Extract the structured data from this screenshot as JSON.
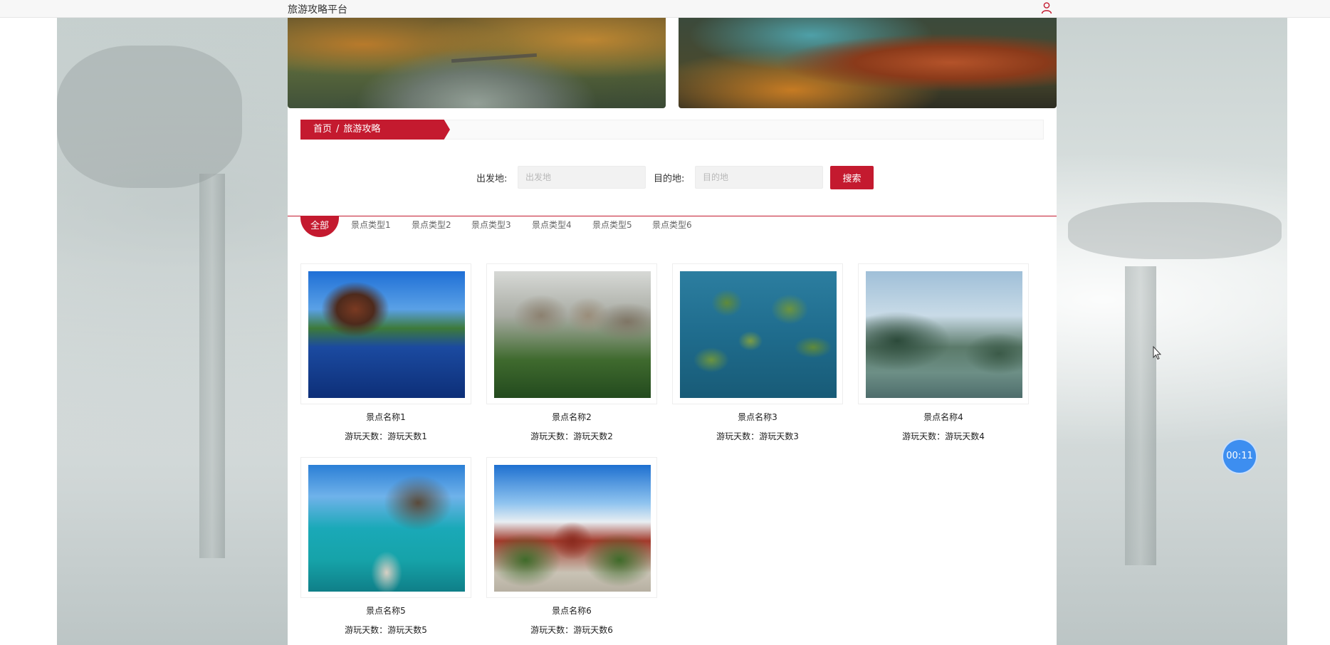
{
  "header": {
    "site_title": "旅游攻略平台",
    "user_icon": "user-icon"
  },
  "breadcrumb": {
    "home": "首页",
    "separator": "/",
    "current": "旅游攻略"
  },
  "search": {
    "departure_label": "出发地:",
    "departure_placeholder": "出发地",
    "destination_label": "目的地:",
    "destination_placeholder": "目的地",
    "button_label": "搜索"
  },
  "categories": [
    "全部",
    "景点类型1",
    "景点类型2",
    "景点类型3",
    "景点类型4",
    "景点类型5",
    "景点类型6"
  ],
  "attractions": [
    {
      "name": "景点名称1",
      "days_label": "游玩天数：",
      "days_value": "游玩天数1"
    },
    {
      "name": "景点名称2",
      "days_label": "游玩天数：",
      "days_value": "游玩天数2"
    },
    {
      "name": "景点名称3",
      "days_label": "游玩天数：",
      "days_value": "游玩天数3"
    },
    {
      "name": "景点名称4",
      "days_label": "游玩天数：",
      "days_value": "游玩天数4"
    },
    {
      "name": "景点名称5",
      "days_label": "游玩天数：",
      "days_value": "游玩天数5"
    },
    {
      "name": "景点名称6",
      "days_label": "游玩天数：",
      "days_value": "游玩天数6"
    }
  ],
  "timer": {
    "value": "00:11"
  },
  "colors": {
    "accent": "#c41a2f",
    "timer_blue": "#3d8ef0"
  }
}
